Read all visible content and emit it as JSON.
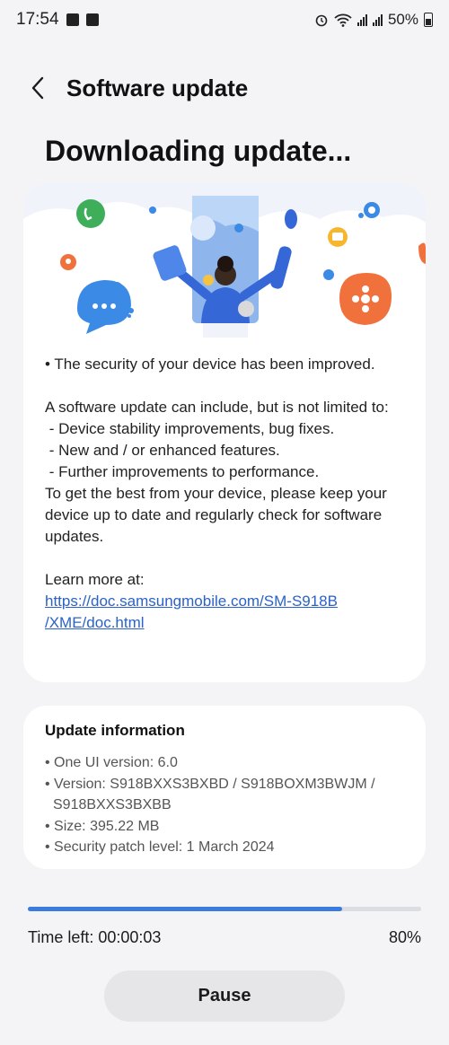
{
  "status_bar": {
    "time": "17:54",
    "battery": "50%"
  },
  "header": {
    "title": "Software update"
  },
  "page": {
    "title": "Downloading update..."
  },
  "release_notes": {
    "bullet": "• The security of your device has been improved.",
    "intro": "A software update can include, but is not limited to:",
    "items": [
      " - Device stability improvements, bug fixes.",
      " - New and / or enhanced features.",
      " - Further improvements to performance."
    ],
    "advice": "To get the best from your device, please keep your device up to date and regularly check for software updates.",
    "learn_more": "Learn more at:",
    "link_line1": "https://doc.samsungmobile.com/SM-S918B",
    "link_line2": "/XME/doc.html"
  },
  "update_info": {
    "title": "Update information",
    "one_ui": "• One UI version: 6.0",
    "version_line1": "• Version: S918BXXS3BXBD / S918BOXM3BWJM /",
    "version_line2": "S918BXXS3BXBB",
    "size": "• Size: 395.22 MB",
    "security_patch": "• Security patch level: 1 March 2024"
  },
  "progress": {
    "fraction": 0.8,
    "time_left": "Time left: 00:00:03",
    "percent_label": "80%"
  },
  "actions": {
    "pause_label": "Pause"
  },
  "colors": {
    "accent": "#3a7bdf",
    "link": "#2a62c9",
    "background": "#f4f4f6"
  }
}
